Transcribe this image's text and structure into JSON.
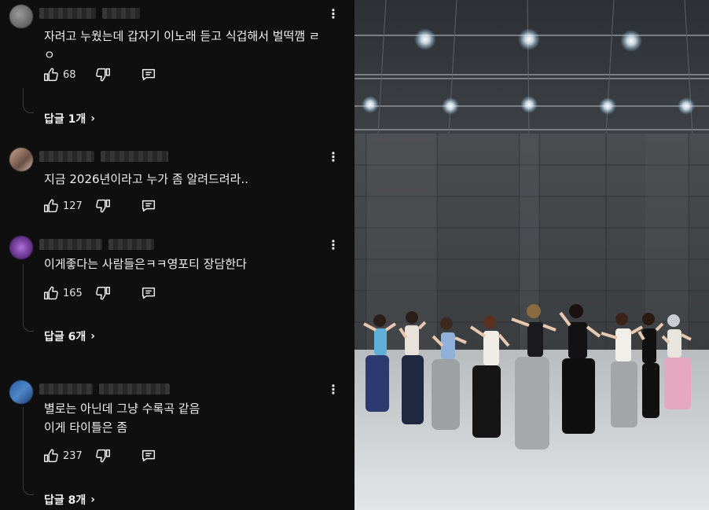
{
  "comments": [
    {
      "text": "자려고 누웠는데 갑자기 이노래 듣고 식겁해서 벌떡깸 ㄹ\nㅇ",
      "likes": "68",
      "replies_label": "답글 1개",
      "avatar_color": "#6b6b6b"
    },
    {
      "text": "지금 2026년이라고 누가 좀 알려드려라..",
      "likes": "127",
      "avatar_color": "#a08070"
    },
    {
      "text": "이게좋다는 사람들은ㅋㅋ영포티 장담한다",
      "likes": "165",
      "replies_label": "답글 6개",
      "avatar_color": "#8a4fb0"
    },
    {
      "text": "별로는 아닌데 그냥 수록곡 같음\n이게 타이틀은 좀",
      "likes": "237",
      "replies_label": "답글 8개",
      "avatar_color": "#3a6fb0"
    }
  ],
  "icons": {
    "more": "more-vertical-icon",
    "like": "thumbs-up-icon",
    "dislike": "thumbs-down-icon",
    "reply": "reply-comment-icon",
    "chevron": "chevron-right-icon"
  },
  "theme": {
    "background": "#0f0f0f",
    "text": "#f1f1f1"
  },
  "video": {
    "description_visible": "dance practice video frame",
    "dancer_count": 9
  }
}
